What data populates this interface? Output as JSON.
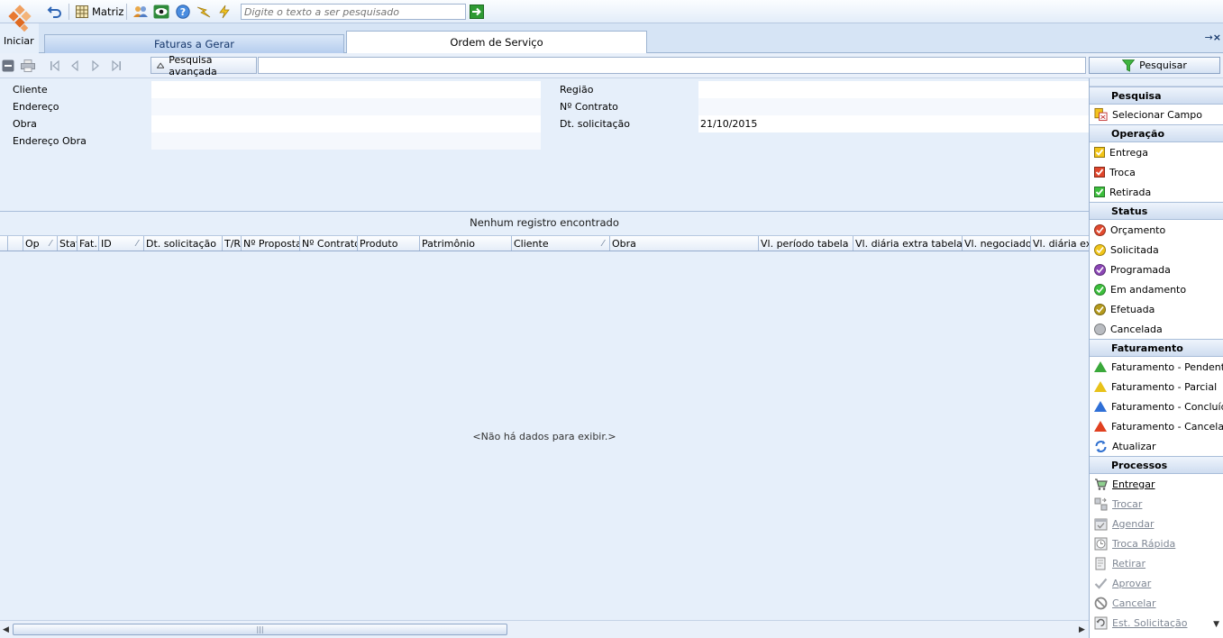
{
  "start": {
    "label": "Iniciar"
  },
  "toolbar": {
    "matriz_label": "Matriz",
    "search_placeholder": "Digite o texto a ser pesquisado"
  },
  "tabs": [
    {
      "label": "Faturas a Gerar"
    },
    {
      "label": "Ordem de Serviço"
    }
  ],
  "nav": {
    "advanced_search_label": "Pesquisa avançada",
    "search_button_label": "Pesquisar"
  },
  "form": {
    "left": [
      {
        "label": "Cliente",
        "value": ""
      },
      {
        "label": "Endereço",
        "value": ""
      },
      {
        "label": "Obra",
        "value": ""
      },
      {
        "label": "Endereço Obra",
        "value": ""
      }
    ],
    "right": [
      {
        "label": "Região",
        "value": ""
      },
      {
        "label": "Nº Contrato",
        "value": ""
      },
      {
        "label": "Dt. solicitação",
        "value": "21/10/2015"
      }
    ]
  },
  "grid": {
    "status_text": "Nenhum registro encontrado",
    "empty_text": "<Não há dados para exibir.>",
    "columns": [
      {
        "label": ""
      },
      {
        "label": "Op"
      },
      {
        "label": "Stat"
      },
      {
        "label": "Fat."
      },
      {
        "label": "ID"
      },
      {
        "label": "Dt. solicitação"
      },
      {
        "label": "T/R"
      },
      {
        "label": "Nº Proposta"
      },
      {
        "label": "Nº Contrato"
      },
      {
        "label": "Produto"
      },
      {
        "label": "Patrimônio"
      },
      {
        "label": "Cliente"
      },
      {
        "label": "Obra"
      },
      {
        "label": "Vl. período tabela"
      },
      {
        "label": "Vl. diária extra tabela"
      },
      {
        "label": "Vl. negociado"
      },
      {
        "label": "Vl. diária extra"
      }
    ]
  },
  "panel": {
    "sections": {
      "pesquisa": "Pesquisa",
      "operacao": "Operação",
      "status": "Status",
      "faturamento": "Faturamento",
      "processos": "Processos"
    },
    "pesquisa_items": [
      "Selecionar Campo"
    ],
    "operacao_items": [
      {
        "label": "Entrega",
        "color": "#f2c417"
      },
      {
        "label": "Troca",
        "color": "#e0452b"
      },
      {
        "label": "Retirada",
        "color": "#3cbf3c"
      }
    ],
    "status_items": [
      {
        "label": "Orçamento",
        "color": "#e24a2e"
      },
      {
        "label": "Solicitada",
        "color": "#f0c419"
      },
      {
        "label": "Programada",
        "color": "#8b45b5"
      },
      {
        "label": "Em andamento",
        "color": "#3cbf3c"
      },
      {
        "label": "Efetuada",
        "color": "#b59a1c"
      },
      {
        "label": "Cancelada",
        "color": "#b9bcc1"
      }
    ],
    "faturamento_items": [
      {
        "label": "Faturamento - Pendente",
        "color": "#3aa83a"
      },
      {
        "label": "Faturamento - Parcial",
        "color": "#e8c21a"
      },
      {
        "label": "Faturamento - Concluído",
        "color": "#2f6fd6"
      },
      {
        "label": "Faturamento - Cancelado",
        "color": "#e04020"
      }
    ],
    "atualizar_label": "Atualizar",
    "processos_items": [
      {
        "label": "Entregar"
      },
      {
        "label": "Trocar"
      },
      {
        "label": "Agendar"
      },
      {
        "label": "Troca Rápida"
      },
      {
        "label": "Retirar"
      },
      {
        "label": "Aprovar"
      },
      {
        "label": "Cancelar"
      },
      {
        "label": "Est. Solicitação"
      }
    ]
  }
}
